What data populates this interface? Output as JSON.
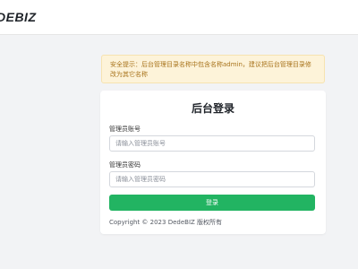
{
  "header": {
    "logo_text": "DEBIZ"
  },
  "notice": {
    "text": "安全提示：后台管理目录名称中包含名称admin，建议把后台管理目录修改为其它名称"
  },
  "login": {
    "title": "后台登录",
    "username_label": "管理员账号",
    "username_placeholder": "请输入管理员账号",
    "username_value": "",
    "password_label": "管理员密码",
    "password_placeholder": "请输入管理员密码",
    "password_value": "",
    "submit_label": "登录",
    "copyright": "Copyright © 2023 DedeBIZ 版权所有"
  },
  "colors": {
    "accent": "#22b462",
    "notice_bg": "#fdf3d9",
    "notice_text": "#a8731b",
    "page_bg": "#f2f3f5"
  }
}
